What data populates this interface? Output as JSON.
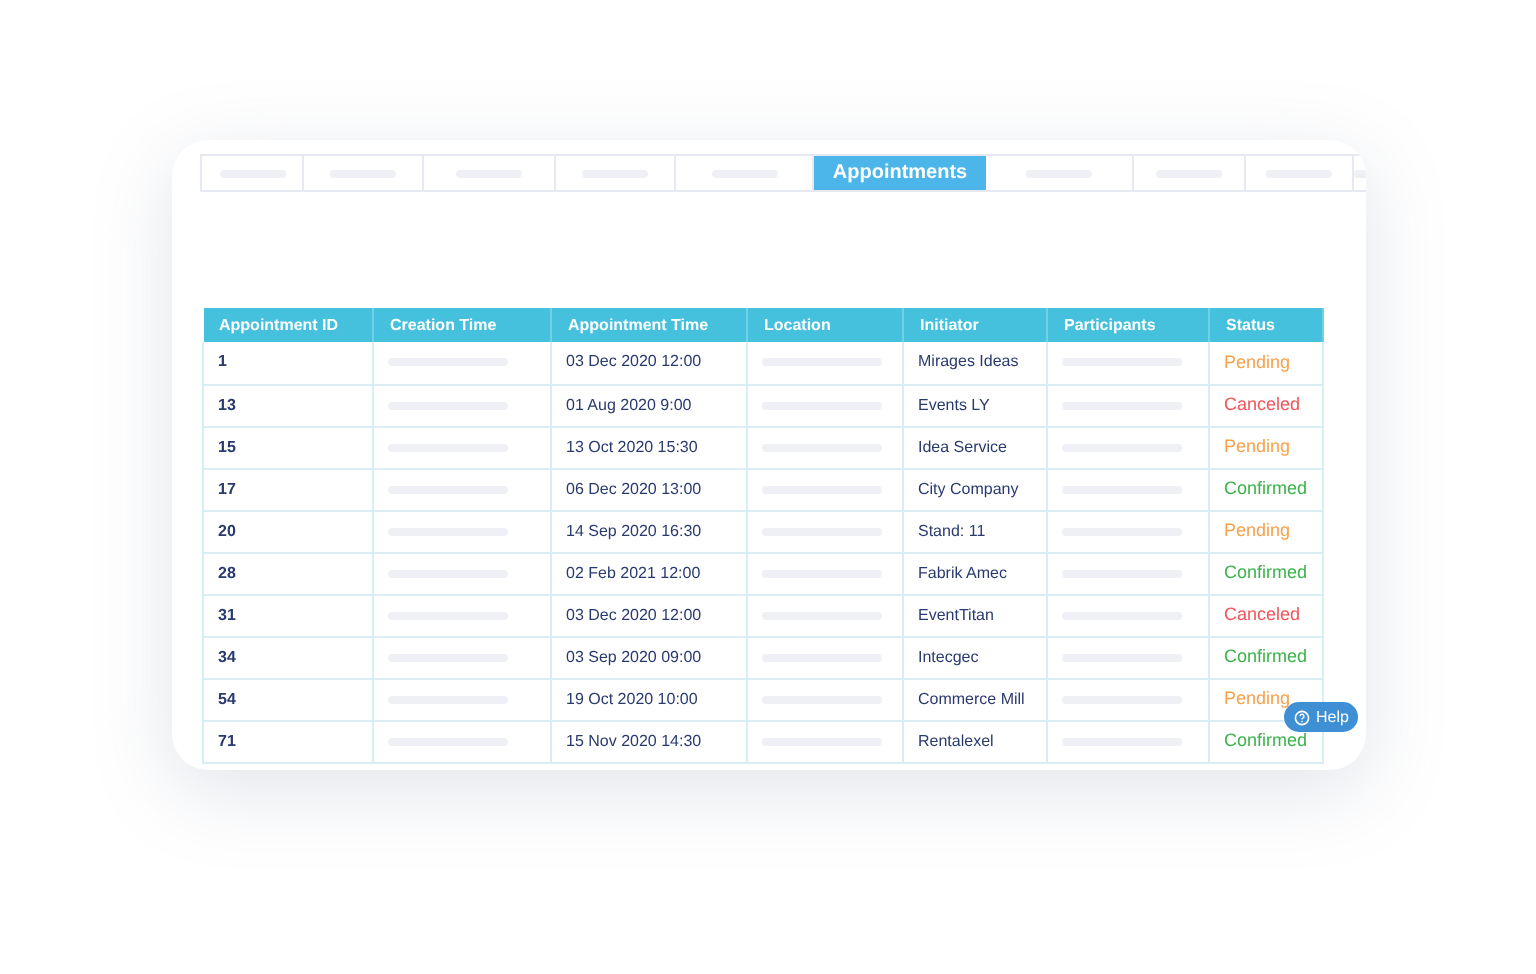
{
  "tabs": [
    {
      "selected": false
    },
    {
      "selected": false
    },
    {
      "selected": false
    },
    {
      "selected": false
    },
    {
      "selected": false
    },
    {
      "label": "Appointments",
      "selected": true
    },
    {
      "selected": false
    },
    {
      "selected": false
    },
    {
      "selected": false
    },
    {
      "selected": false
    }
  ],
  "table": {
    "columns": [
      "Appointment ID",
      "Creation Time",
      "Appointment Time",
      "Location",
      "Initiator",
      "Participants",
      "Status"
    ],
    "rows": [
      {
        "id": "1",
        "appointment_time": "03 Dec 2020 12:00",
        "initiator": "Mirages Ideas",
        "status": "Pending",
        "color": "#f7a14a"
      },
      {
        "id": "13",
        "appointment_time": "01 Aug 2020 9:00",
        "initiator": "Events LY",
        "status": "Canceled",
        "color": "#f0555a"
      },
      {
        "id": "15",
        "appointment_time": "13 Oct 2020 15:30",
        "initiator": "Idea Service",
        "status": "Pending",
        "color": "#f7a14a"
      },
      {
        "id": "17",
        "appointment_time": "06 Dec 2020 13:00",
        "initiator": "City Company",
        "status": "Confirmed",
        "color": "#3bb34a"
      },
      {
        "id": "20",
        "appointment_time": "14 Sep 2020 16:30",
        "initiator": "Stand: 11",
        "status": "Pending",
        "color": "#f7a14a"
      },
      {
        "id": "28",
        "appointment_time": "02 Feb 2021 12:00",
        "initiator": "Fabrik Amec",
        "status": "Confirmed",
        "color": "#3bb34a"
      },
      {
        "id": "31",
        "appointment_time": "03 Dec 2020 12:00",
        "initiator": "EventTitan",
        "status": "Canceled",
        "color": "#f0555a"
      },
      {
        "id": "34",
        "appointment_time": "03 Sep 2020 09:00",
        "initiator": "Intecgec",
        "status": "Confirmed",
        "color": "#3bb34a"
      },
      {
        "id": "54",
        "appointment_time": "19 Oct 2020 10:00",
        "initiator": "Commerce Mill",
        "status": "Pending",
        "color": "#f7a14a"
      },
      {
        "id": "71",
        "appointment_time": "15 Nov 2020 14:30",
        "initiator": "Rentalexel",
        "status": "Confirmed",
        "color": "#3bb34a"
      }
    ]
  },
  "help_button": {
    "label": "Help"
  }
}
